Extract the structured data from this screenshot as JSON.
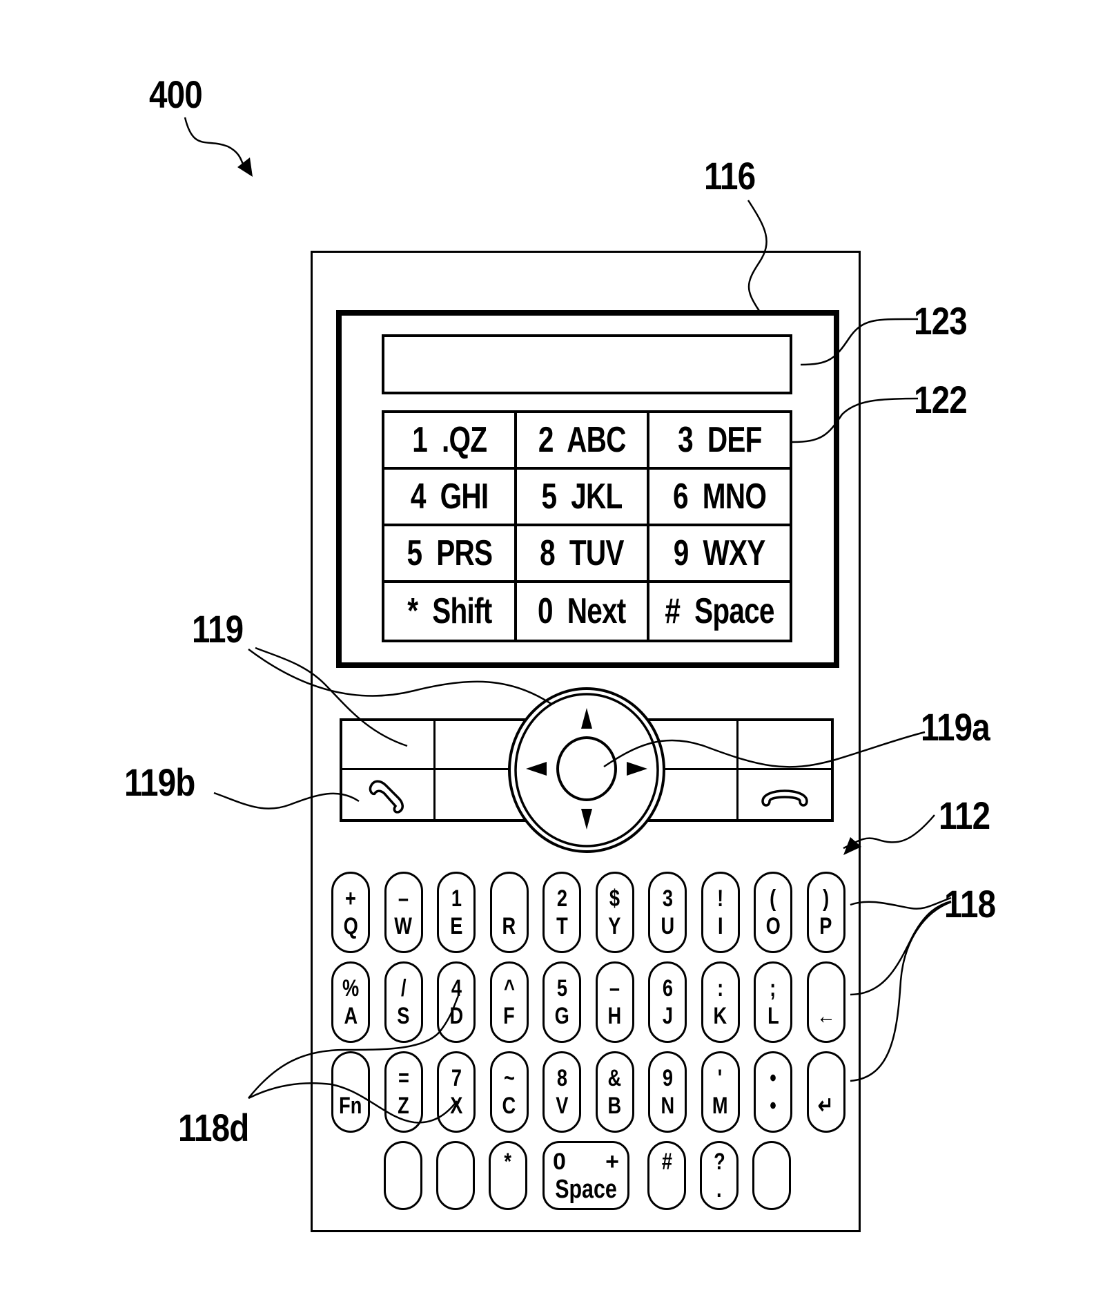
{
  "figure": {
    "ref_labels": {
      "device": "400",
      "display": "116",
      "input_window": "123",
      "virtual_keypad": "122",
      "nav_keys": "119",
      "nav_center": "119a",
      "call_key": "119b",
      "keyboard": "112",
      "keys": "118",
      "fn_keys": "118d"
    }
  },
  "screen": {
    "input_text": "",
    "keypad": [
      {
        "num": "1",
        "letters": ".QZ"
      },
      {
        "num": "2",
        "letters": "ABC"
      },
      {
        "num": "3",
        "letters": "DEF"
      },
      {
        "num": "4",
        "letters": "GHI"
      },
      {
        "num": "5",
        "letters": "JKL"
      },
      {
        "num": "6",
        "letters": "MNO"
      },
      {
        "num": "5",
        "letters": "PRS"
      },
      {
        "num": "8",
        "letters": "TUV"
      },
      {
        "num": "9",
        "letters": "WXY"
      },
      {
        "num": "*",
        "letters": "Shift"
      },
      {
        "num": "0",
        "letters": "Next"
      },
      {
        "num": "#",
        "letters": "Space"
      }
    ]
  },
  "navigation": {
    "up_icon": "▲",
    "down_icon": "▼",
    "left_icon": "◀",
    "right_icon": "▶",
    "send_icon": "call-send",
    "end_icon": "call-end"
  },
  "keyboard": {
    "row1": [
      {
        "top": "+",
        "bottom": "Q"
      },
      {
        "top": "–",
        "bottom": "W"
      },
      {
        "top": "1",
        "bottom": "E"
      },
      {
        "top": "",
        "bottom": "R"
      },
      {
        "top": "2",
        "bottom": "T"
      },
      {
        "top": "$",
        "bottom": "Y"
      },
      {
        "top": "3",
        "bottom": "U"
      },
      {
        "top": "!",
        "bottom": "I"
      },
      {
        "top": "(",
        "bottom": "O"
      },
      {
        "top": ")",
        "bottom": "P"
      }
    ],
    "row2": [
      {
        "top": "%",
        "bottom": "A"
      },
      {
        "top": "/",
        "bottom": "S"
      },
      {
        "top": "4",
        "bottom": "D"
      },
      {
        "top": "^",
        "bottom": "F"
      },
      {
        "top": "5",
        "bottom": "G"
      },
      {
        "top": "–",
        "bottom": "H"
      },
      {
        "top": "6",
        "bottom": "J"
      },
      {
        "top": ":",
        "bottom": "K"
      },
      {
        "top": ";",
        "bottom": "L"
      },
      {
        "top": "",
        "bottom": "←"
      }
    ],
    "row3": [
      {
        "top": "",
        "bottom": "Fn"
      },
      {
        "top": "=",
        "bottom": "Z"
      },
      {
        "top": "7",
        "bottom": "X"
      },
      {
        "top": "~",
        "bottom": "C"
      },
      {
        "top": "8",
        "bottom": "V"
      },
      {
        "top": "&",
        "bottom": "B"
      },
      {
        "top": "9",
        "bottom": "N"
      },
      {
        "top": "'",
        "bottom": "M"
      },
      {
        "top": "•",
        "bottom": "•"
      },
      {
        "top": "",
        "bottom": "↵"
      }
    ],
    "row4": [
      {
        "top": "",
        "bottom": ""
      },
      {
        "top": "",
        "bottom": ""
      },
      {
        "top": "*",
        "bottom": ""
      },
      {
        "top": "0",
        "top_right": "+",
        "bottom": "Space"
      },
      {
        "top": "#",
        "bottom": ""
      },
      {
        "top": "?",
        "bottom": "."
      },
      {
        "top": "",
        "bottom": ""
      }
    ]
  }
}
